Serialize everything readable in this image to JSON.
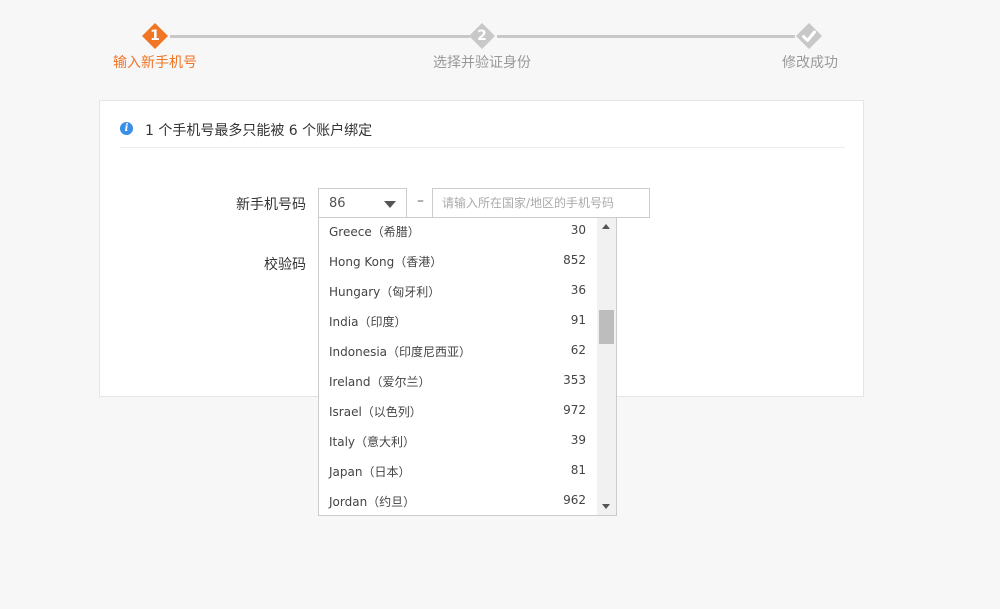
{
  "stepper": {
    "steps": [
      {
        "number": "1",
        "label": "输入新手机号",
        "state": "active"
      },
      {
        "number": "2",
        "label": "选择并验证身份",
        "state": "pending"
      },
      {
        "number": "check-icon",
        "label": "修改成功",
        "state": "pending"
      }
    ],
    "active_color": "#f07524",
    "inactive_color": "#c8c8c8"
  },
  "notice": {
    "icon": "info-icon",
    "text": "1 个手机号最多只能被 6 个账户绑定"
  },
  "form": {
    "phone_label": "新手机号码",
    "country_code_value": "86",
    "dash": "–",
    "phone_placeholder": "请输入所在国家/地区的手机号码",
    "code_label": "校验码"
  },
  "dropdown": {
    "options": [
      {
        "name": "Greece（希腊）",
        "code": "30"
      },
      {
        "name": "Hong Kong（香港）",
        "code": "852"
      },
      {
        "name": "Hungary（匈牙利）",
        "code": "36"
      },
      {
        "name": "India（印度）",
        "code": "91"
      },
      {
        "name": "Indonesia（印度尼西亚）",
        "code": "62"
      },
      {
        "name": "Ireland（爱尔兰）",
        "code": "353"
      },
      {
        "name": "Israel（以色列）",
        "code": "972"
      },
      {
        "name": "Italy（意大利）",
        "code": "39"
      },
      {
        "name": "Japan（日本）",
        "code": "81"
      },
      {
        "name": "Jordan（约旦）",
        "code": "962"
      }
    ]
  }
}
